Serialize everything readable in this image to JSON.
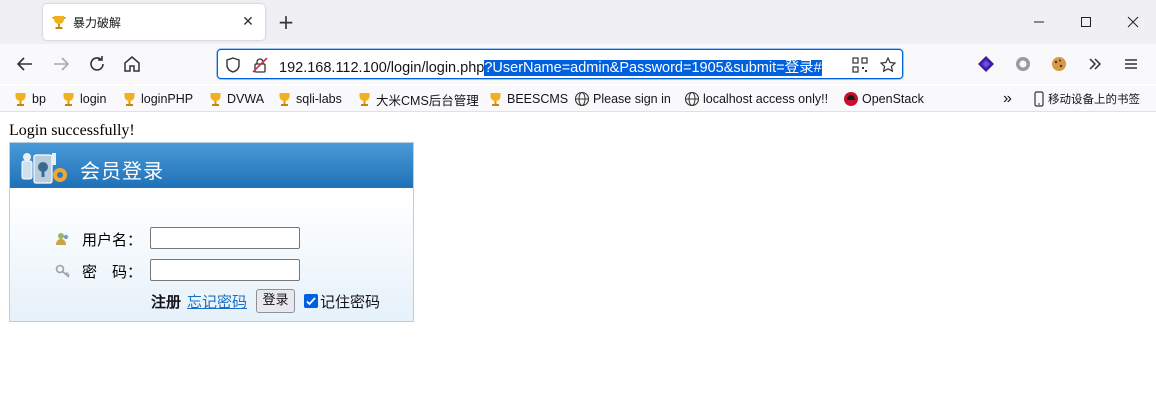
{
  "tab": {
    "title": "暴力破解",
    "close_glyph": "✕",
    "new_tab_glyph": "+"
  },
  "window": {
    "minimize_glyph": "—",
    "maximize_glyph": "☐",
    "close_glyph": "✕"
  },
  "urlbar": {
    "url_plain": "192.168.112.100/login/login.php",
    "url_selected": "?UserName=admin&Password=1905&submit=登录#"
  },
  "bookmarks": {
    "items": [
      "bp",
      "login",
      "loginPHP",
      "DVWA",
      "sqli-labs",
      "大米CMS后台管理",
      "BEESCMS",
      "Please sign in",
      "localhost access only!!",
      "OpenStack"
    ],
    "mobile": "移动设备上的书签",
    "overflow_glyph": "»"
  },
  "page": {
    "message": "Login successfully!",
    "panel_title": "会员登录",
    "username_label": "用户名：",
    "password_label": "密　码：",
    "register_link": "注册",
    "forgot_link": "忘记密码",
    "login_button": "登录",
    "remember_label": "记住密码",
    "username_value": "",
    "password_value": ""
  },
  "colors": {
    "accent": "#0061e0",
    "panel_header": "#2a7cc2",
    "link": "#1a6ec2"
  }
}
